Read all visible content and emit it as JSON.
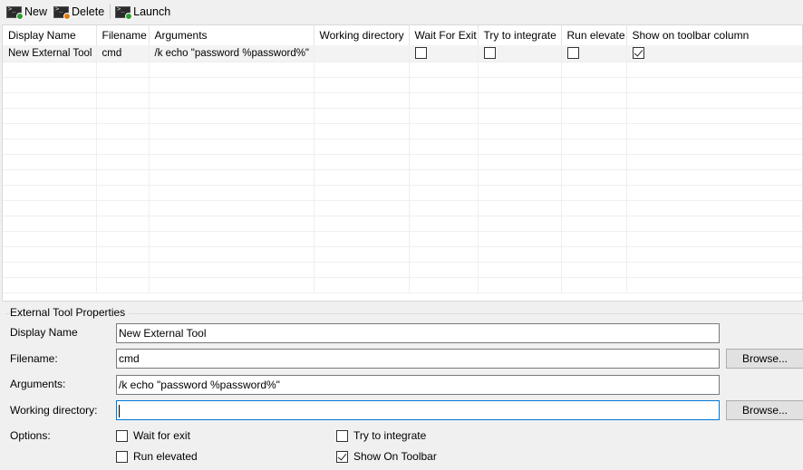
{
  "toolbar": {
    "new_label": "New",
    "delete_label": "Delete",
    "launch_label": "Launch"
  },
  "grid": {
    "columns": [
      "Display Name",
      "Filename",
      "Arguments",
      "Working directory",
      "Wait For Exit",
      "Try to integrate",
      "Run elevate",
      "Show on toolbar column"
    ],
    "rows": [
      {
        "display_name": "New External Tool",
        "filename": "cmd",
        "arguments": "/k echo \"password %password%\"",
        "working_directory": "",
        "wait_for_exit": false,
        "try_to_integrate": false,
        "run_elevated": false,
        "show_on_toolbar": true
      }
    ]
  },
  "properties": {
    "group_title": "External Tool Properties",
    "display_name_label": "Display Name",
    "display_name_value": "New External Tool",
    "filename_label": "Filename:",
    "filename_value": "cmd",
    "arguments_label": "Arguments:",
    "arguments_value": "/k echo \"password %password%\"",
    "working_directory_label": "Working directory:",
    "working_directory_value": "",
    "browse_label": "Browse...",
    "options_label": "Options:",
    "wait_for_exit_label": "Wait for exit",
    "run_elevated_label": "Run elevated",
    "try_to_integrate_label": "Try to integrate",
    "show_on_toolbar_label": "Show On Toolbar",
    "wait_for_exit": false,
    "run_elevated": false,
    "try_to_integrate": false,
    "show_on_toolbar": true
  }
}
